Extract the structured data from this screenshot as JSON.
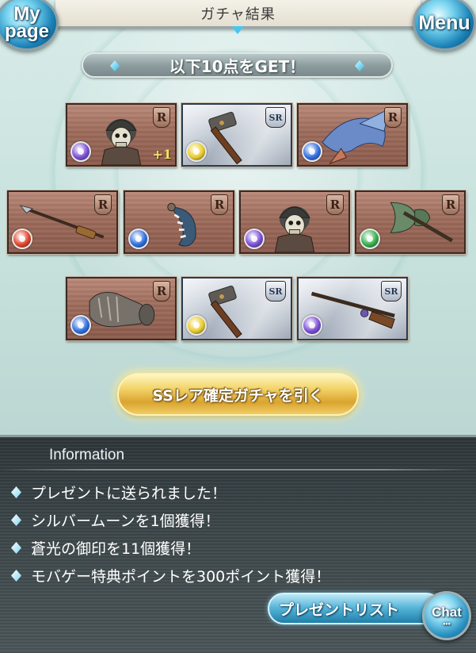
{
  "header": {
    "title": "ガチャ結果",
    "mypage_label_1": "My",
    "mypage_label_2": "page",
    "menu_label": "Menu"
  },
  "result_banner": "以下10点をGET！",
  "items": [
    {
      "name": "skeleton-soldier",
      "rarity": "R",
      "element": "dark",
      "element_color": "#7b4fd6",
      "bonus": "+1"
    },
    {
      "name": "war-hammer",
      "rarity": "SR",
      "element": "light",
      "element_color": "#e8cc2a",
      "bonus": ""
    },
    {
      "name": "blue-wyvern",
      "rarity": "R",
      "element": "water",
      "element_color": "#2f6fe0",
      "bonus": ""
    },
    {
      "name": "long-spear",
      "rarity": "R",
      "element": "fire",
      "element_color": "#e0452a",
      "bonus": ""
    },
    {
      "name": "fang-blade",
      "rarity": "R",
      "element": "water",
      "element_color": "#2f6fe0",
      "bonus": ""
    },
    {
      "name": "skeleton-soldier",
      "rarity": "R",
      "element": "dark",
      "element_color": "#7b4fd6",
      "bonus": ""
    },
    {
      "name": "battle-axe",
      "rarity": "R",
      "element": "wind",
      "element_color": "#35b04a",
      "bonus": ""
    },
    {
      "name": "gauntlet",
      "rarity": "R",
      "element": "water",
      "element_color": "#2f6fe0",
      "bonus": ""
    },
    {
      "name": "war-hammer",
      "rarity": "SR",
      "element": "light",
      "element_color": "#e8cc2a",
      "bonus": ""
    },
    {
      "name": "musket",
      "rarity": "SR",
      "element": "dark",
      "element_color": "#7b4fd6",
      "bonus": ""
    }
  ],
  "gacha_button": "SSレア確定ガチャを引く",
  "information": {
    "title": "Information",
    "lines": [
      "プレゼントに送られました！",
      "シルバームーンを1個獲得！",
      "蒼光の御印を11個獲得！",
      "モバゲー特典ポイントを300ポイント獲得！"
    ],
    "present_list_button": "プレゼントリスト",
    "chat_label": "Chat",
    "chat_dots": "•••"
  },
  "colors": {
    "accent": "#2fb7ea",
    "gold": "#f3d46a",
    "r_card": "#9c6a5a",
    "sr_card": "#b8c1cc"
  }
}
